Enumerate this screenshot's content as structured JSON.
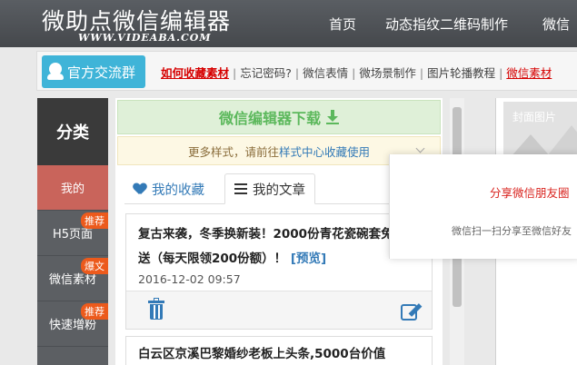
{
  "header": {
    "logo": "微助点微信编辑器",
    "logo_sub": "WWW.VIDEABA.COM",
    "nav": [
      "首页",
      "动态指纹二维码制作",
      "微信"
    ]
  },
  "linkbar": {
    "qq_button": "官方交流群",
    "links": [
      "如何收藏素材",
      "忘记密码?",
      "微信表情",
      "微场景制作",
      "图片轮播教程",
      "微信素材"
    ]
  },
  "sidebar": {
    "title": "分类",
    "items": [
      {
        "label": "我的",
        "badge": ""
      },
      {
        "label": "H5页面",
        "badge": "推荐"
      },
      {
        "label": "微信素材",
        "badge": "爆文"
      },
      {
        "label": "快速增粉",
        "badge": "推荐"
      }
    ]
  },
  "main": {
    "download": "微信编辑器下载",
    "notice_prefix": "更多样式，请前往",
    "notice_link": "样式中心收藏使用",
    "tabs": [
      "我的收藏",
      "我的文章"
    ],
    "articles": [
      {
        "title": "复古来袭，冬季换新装！2000份青花瓷碗套免费送（每天限领200份额）！",
        "preview": "[预览]",
        "date": "2016-12-02 09:57"
      },
      {
        "title": "白云区京溪巴黎婚纱老板上头条,5000台价值"
      }
    ]
  },
  "preview_panel": {
    "cover_label": "封面图片"
  },
  "popup": {
    "title": "分享微信朋友圈",
    "text": "微信扫一扫分享至微信好友"
  }
}
